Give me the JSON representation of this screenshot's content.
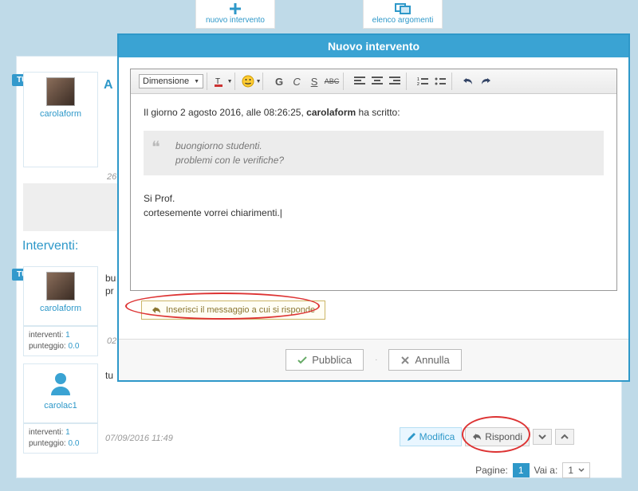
{
  "topbar": {
    "new_post": "nuovo intervento",
    "topic_list": "elenco argomenti"
  },
  "modal": {
    "title": "Nuovo intervento",
    "toolbar": {
      "font_size_label": "Dimensione",
      "bold": "G",
      "italic": "C",
      "strike": "S",
      "abc": "ABC"
    },
    "editor": {
      "quote_intro_prefix": "Il giorno 2 agosto 2016, alle 08:26:25, ",
      "quote_intro_author": "carolaform",
      "quote_intro_suffix": " ha scritto:",
      "quote_line1": "buongiorno studenti.",
      "quote_line2": "problemi con le verifiche?",
      "body_line1": "Si Prof.",
      "body_line2": "cortesemente vorrei chiarimenti."
    },
    "insert_quote_btn": "Inserisci il messaggio a cui si risponde",
    "publish": "Pubblica",
    "cancel": "Annulla"
  },
  "background": {
    "tutor_badge": "TUTOR",
    "user1": "carolaform",
    "user2": "carolaform",
    "user3": "carolac1",
    "heading_a": "A",
    "ts1": "26",
    "ts2": "02",
    "ts3": "07/09/2016 11:49",
    "partial_bu": "bu",
    "partial_pr": "pr",
    "partial_tu": "tu",
    "interventi_label": "Interventi:",
    "stats": {
      "interventi_label": "interventi:",
      "interventi_value": "1",
      "score_label": "punteggio:",
      "score_value": "0.0"
    },
    "buttons": {
      "modify": "Modifica",
      "reply": "Rispondi"
    },
    "pager": {
      "pages_label": "Pagine:",
      "current": "1",
      "goto_label": "Vai a:",
      "goto_value": "1"
    }
  }
}
